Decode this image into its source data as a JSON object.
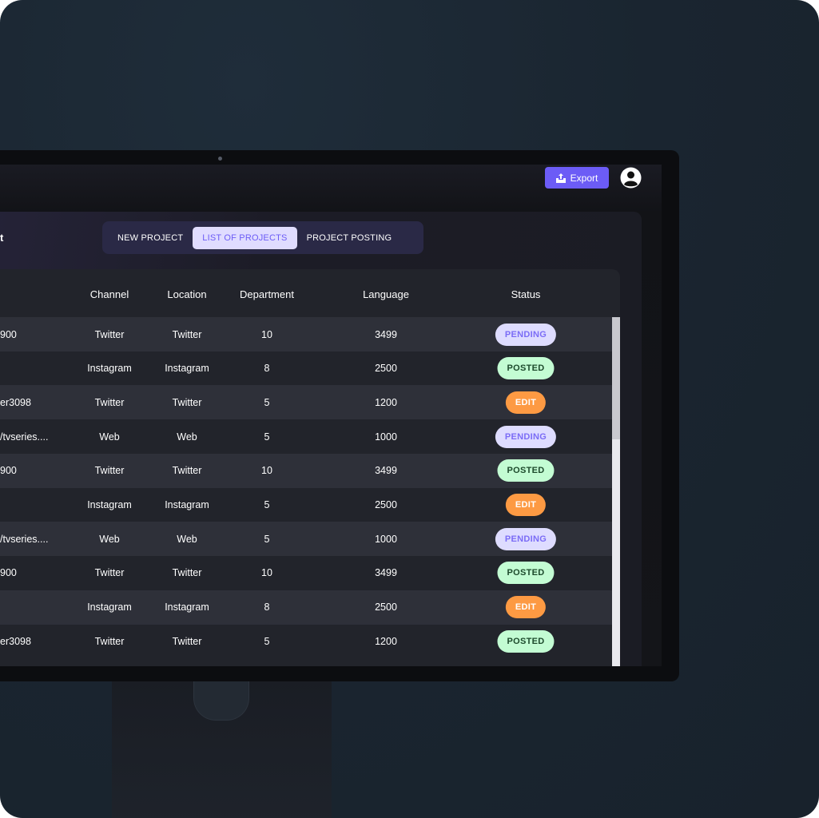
{
  "header": {
    "export_label": "Export",
    "export_icon": "upload-icon",
    "avatar_icon": "user-circle-icon"
  },
  "page": {
    "title_fragment": "t"
  },
  "tabs": [
    {
      "label": "NEW PROJECT",
      "active": false
    },
    {
      "label": "LIST OF PROJECTS",
      "active": true
    },
    {
      "label": "PROJECT POSTING",
      "active": false
    }
  ],
  "table": {
    "columns": [
      "Channel",
      "Location",
      "Department",
      "Language",
      "Status"
    ],
    "rows": [
      {
        "first": "900",
        "channel": "Twitter",
        "location": "Twitter",
        "department": "10",
        "language": "3499",
        "status": "PENDING"
      },
      {
        "first": "",
        "channel": "Instagram",
        "location": "Instagram",
        "department": "8",
        "language": "2500",
        "status": "POSTED"
      },
      {
        "first": "er3098",
        "channel": "Twitter",
        "location": "Twitter",
        "department": "5",
        "language": "1200",
        "status": "EDIT"
      },
      {
        "first": "/tvseries....",
        "channel": "Web",
        "location": "Web",
        "department": "5",
        "language": "1000",
        "status": "PENDING"
      },
      {
        "first": "900",
        "channel": "Twitter",
        "location": "Twitter",
        "department": "10",
        "language": "3499",
        "status": "POSTED"
      },
      {
        "first": "",
        "channel": "Instagram",
        "location": "Instagram",
        "department": "5",
        "language": "2500",
        "status": "EDIT"
      },
      {
        "first": "/tvseries....",
        "channel": "Web",
        "location": "Web",
        "department": "5",
        "language": "1000",
        "status": "PENDING"
      },
      {
        "first": "900",
        "channel": "Twitter",
        "location": "Twitter",
        "department": "10",
        "language": "3499",
        "status": "POSTED"
      },
      {
        "first": "",
        "channel": "Instagram",
        "location": "Instagram",
        "department": "8",
        "language": "2500",
        "status": "EDIT"
      },
      {
        "first": "er3098",
        "channel": "Twitter",
        "location": "Twitter",
        "department": "5",
        "language": "1200",
        "status": "POSTED"
      }
    ]
  },
  "colors": {
    "accent": "#6c5cf6",
    "pending": "#dedcff",
    "posted": "#c3fcd3",
    "edit": "#fd9a43"
  }
}
